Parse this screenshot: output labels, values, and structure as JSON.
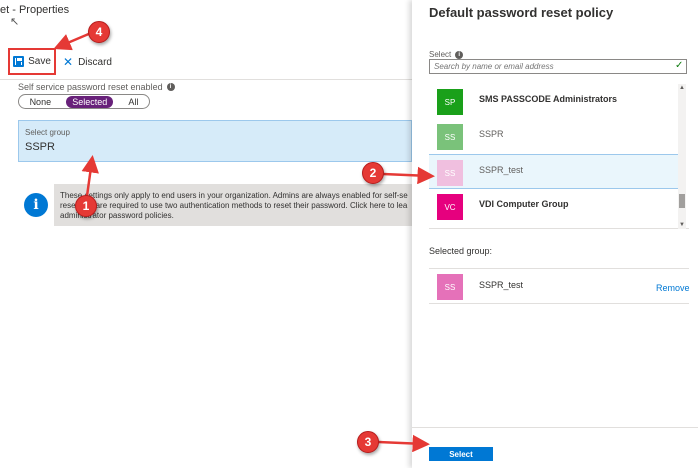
{
  "left": {
    "title": "et - Properties",
    "toolbar": {
      "save_label": "Save",
      "discard_label": "Discard"
    },
    "sspr": {
      "label": "Self service password reset enabled",
      "options": [
        "None",
        "Selected",
        "All"
      ],
      "selected": "Selected"
    },
    "select_group": {
      "label": "Select group",
      "value": "SSPR"
    },
    "notice": {
      "lines": [
        "These settings only apply to end users in your organization. Admins are always enabled for self-se",
        "reset and are required to use two authentication methods to reset their password. Click here to lea",
        "administrator password policies."
      ]
    }
  },
  "right": {
    "title": "Default password reset policy",
    "select_label": "Select",
    "search_placeholder": "Search by name or email address",
    "groups": [
      {
        "initials": "SP",
        "name": "SMS PASSCODE Administrators",
        "color": "#1aa01a",
        "style": "bold"
      },
      {
        "initials": "SS",
        "name": "SSPR",
        "color": "#7ac27a",
        "style": "muted"
      },
      {
        "initials": "SS",
        "name": "SSPR_test",
        "color": "#f0bfdf",
        "style": "muted"
      },
      {
        "initials": "VC",
        "name": "VDI Computer Group",
        "color": "#e6007e",
        "style": "bold"
      }
    ],
    "selected_group_label": "Selected group:",
    "selected_group": {
      "initials": "SS",
      "name": "SSPR_test",
      "color": "#e571b9"
    },
    "remove_label": "Remove",
    "select_button": "Select"
  },
  "callouts": [
    "1",
    "2",
    "3",
    "4"
  ],
  "colors": {
    "accent": "#0078d4",
    "toggle": "#68217a",
    "callout": "#e53935"
  }
}
